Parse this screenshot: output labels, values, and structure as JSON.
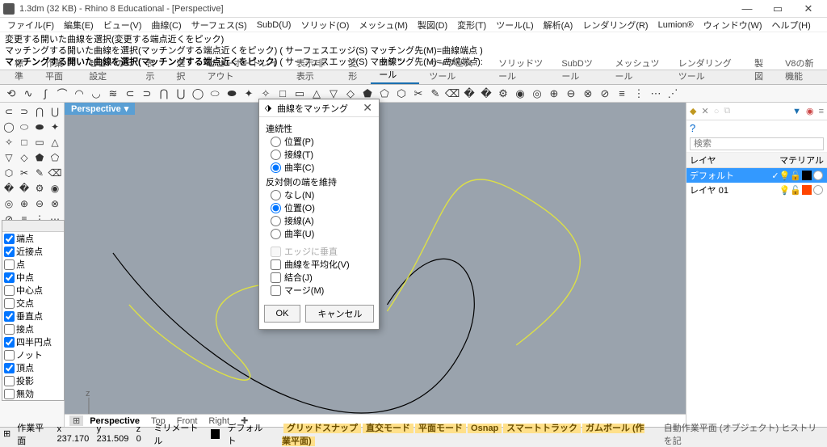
{
  "title": "1.3dm (32 KB) - Rhino 8 Educational - [Perspective]",
  "menu": [
    "ファイル(F)",
    "編集(E)",
    "ビュー(V)",
    "曲線(C)",
    "サーフェス(S)",
    "SubD(U)",
    "ソリッド(O)",
    "メッシュ(M)",
    "製図(D)",
    "変形(T)",
    "ツール(L)",
    "解析(A)",
    "レンダリング(R)",
    "Lumion®",
    "ウィンドウ(W)",
    "ヘルプ(H)"
  ],
  "cmd": {
    "l1": "変更する開いた曲線を選択(変更する端点近くをピック)",
    "l2": "マッチングする開いた曲線を選択(マッチングする端点近くをピック) ( サーフェスエッジ(S)  マッチング先(M)=曲線端点 )",
    "l3a": "マッチングする開いた曲線を選択(マッチングする端点近くをピック)",
    "l3b": " ( サーフェスエッジ(S)  マッチング先(M)=",
    "l3c": "曲線端点",
    "l3d": "):"
  },
  "tabs": [
    "標準",
    "作業平面",
    "ビューの設定",
    "表示",
    "選択",
    "ビューポートレイアウト",
    "表示/非表示",
    "変形",
    "曲線ツール",
    "サーフェスツール",
    "ソリッドツール",
    "SubDツール",
    "メッシュツール",
    "レンダリングツール",
    "製図",
    "V8の新機能"
  ],
  "activeTab": "曲線ツール",
  "viewLabel": "Perspective",
  "osnap": [
    [
      "端点",
      true
    ],
    [
      "近接点",
      true
    ],
    [
      "点",
      false
    ],
    [
      "中点",
      true
    ],
    [
      "中心点",
      false
    ],
    [
      "交点",
      false
    ],
    [
      "垂直点",
      true
    ],
    [
      "接点",
      false
    ],
    [
      "四半円点",
      true
    ],
    [
      "ノット",
      false
    ],
    [
      "頂点",
      true
    ],
    [
      "投影",
      false
    ],
    [
      "無効",
      false
    ]
  ],
  "layerPanel": {
    "tab": "レイヤ",
    "search": "検索",
    "colLayer": "レイヤ",
    "colMat": "マテリアル",
    "rows": [
      {
        "name": "デフォルト",
        "sel": true,
        "c": "#000",
        "m": "#fff"
      },
      {
        "name": "レイヤ 01",
        "sel": false,
        "c": "#ff4500",
        "m": "#fff"
      }
    ]
  },
  "footerViews": [
    "Perspective",
    "Top",
    "Front",
    "Right"
  ],
  "status": {
    "workplane": "作業平面",
    "x": "x 237.170",
    "y": "y 231.509",
    "z": "z 0",
    "unit": "ミリメートル",
    "layer": "デフォルト",
    "btns": [
      "グリッドスナップ",
      "直交モード",
      "平面モード",
      "Osnap",
      "スマートトラック",
      "ガムボール (作業平面)"
    ],
    "right": "自動作業平面 (オブジェクト)   ヒストリを記"
  },
  "dialog": {
    "title": "曲線をマッチング",
    "secCont": "連続性",
    "cont": [
      [
        "位置(P)",
        false
      ],
      [
        "接線(T)",
        false
      ],
      [
        "曲率(C)",
        true
      ]
    ],
    "secOther": "反対側の端を維持",
    "other": [
      [
        "なし(N)",
        false
      ],
      [
        "位置(O)",
        true
      ],
      [
        "接線(A)",
        false
      ],
      [
        "曲率(U)",
        false
      ]
    ],
    "chk": [
      [
        "エッジに垂直",
        false,
        true
      ],
      [
        "曲線を平均化(V)",
        false,
        false
      ],
      [
        "結合(J)",
        false,
        false
      ],
      [
        "マージ(M)",
        false,
        false
      ]
    ],
    "ok": "OK",
    "cancel": "キャンセル"
  }
}
